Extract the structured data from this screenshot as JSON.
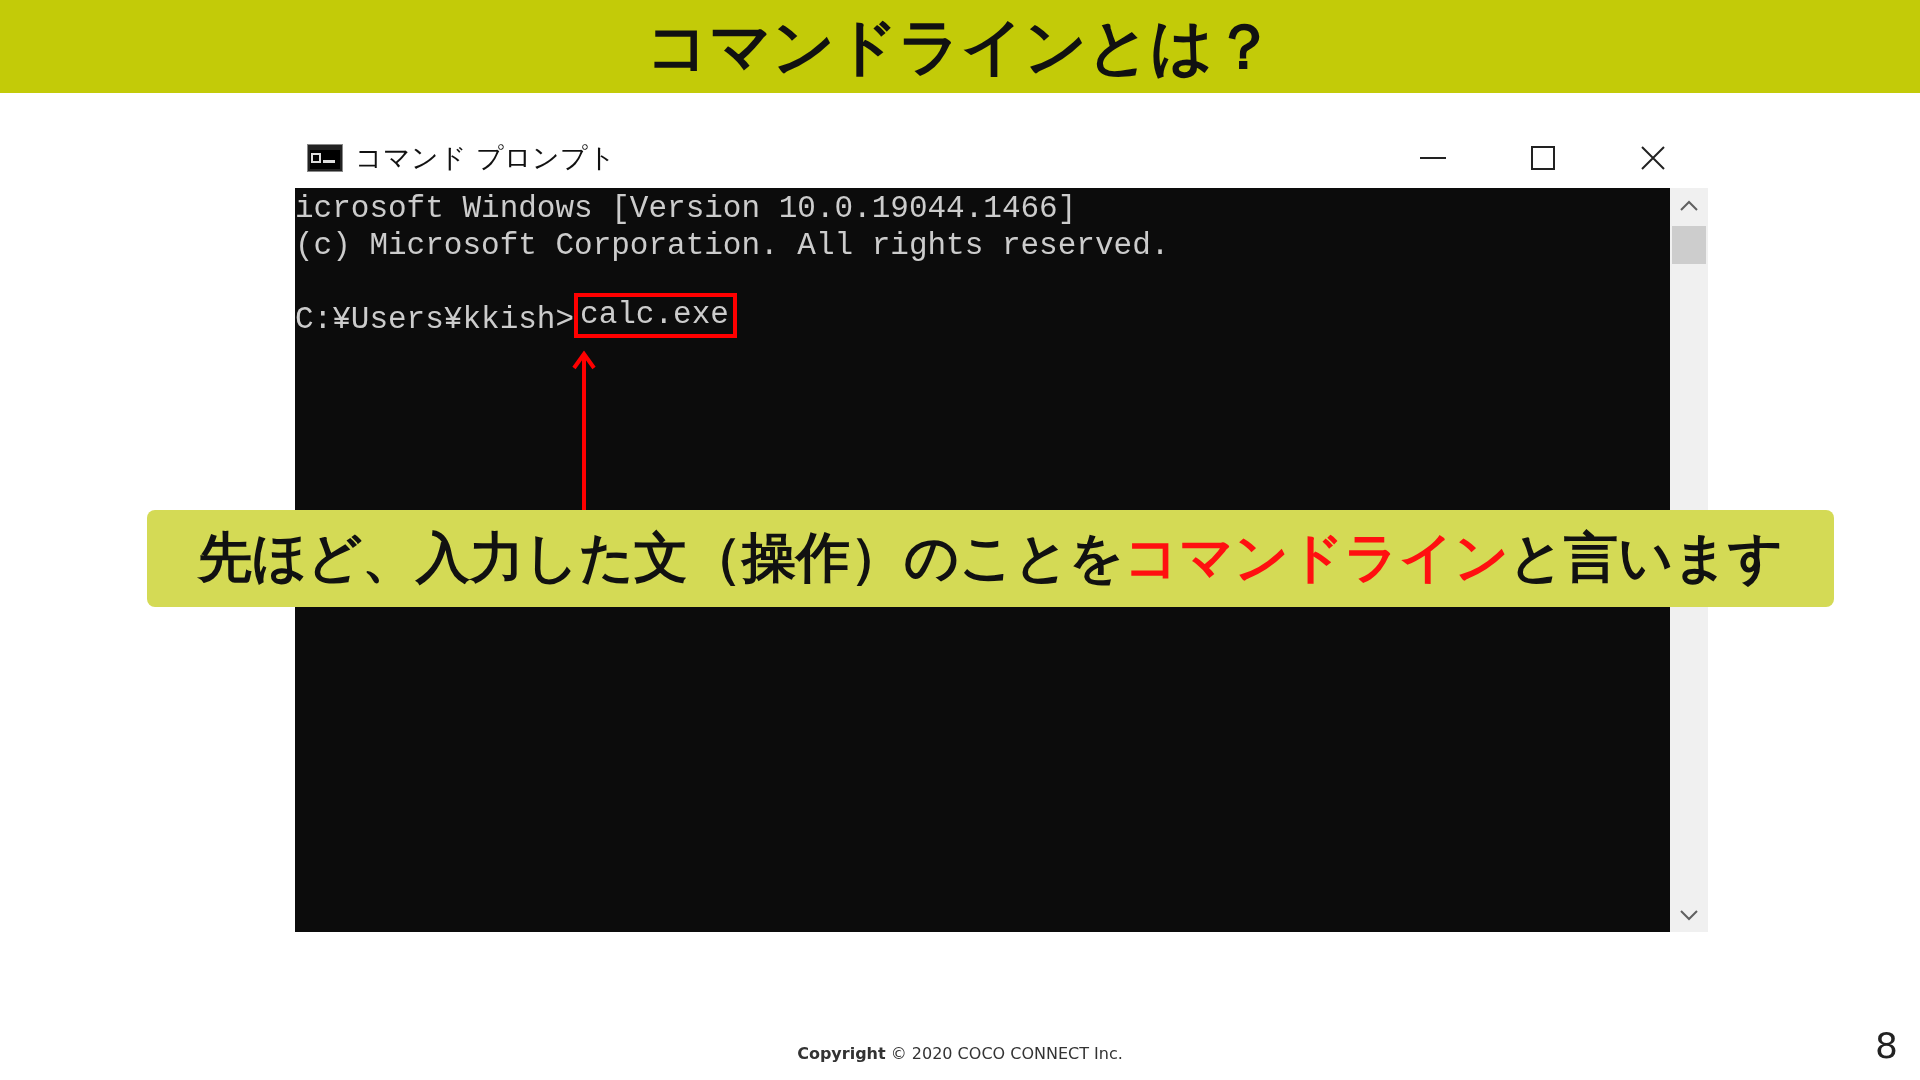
{
  "slide_title": "コマンドラインとは？",
  "window": {
    "title": "コマンド プロンプト",
    "console_lines": [
      {
        "kind": "plain",
        "text": "icrosoft Windows [Version 10.0.19044.1466]"
      },
      {
        "kind": "plain",
        "text": "(c) Microsoft Corporation. All rights reserved."
      },
      {
        "kind": "blank"
      },
      {
        "kind": "command",
        "prompt": "C:¥Users¥kkish>",
        "command": "calc.exe",
        "highlighted": true
      }
    ]
  },
  "callout": {
    "segments": [
      {
        "text": "先ほど、入力した文（操作）のことを",
        "emphasis": false
      },
      {
        "text": "コマンドライン",
        "emphasis": true
      },
      {
        "text": "と言います",
        "emphasis": false
      }
    ]
  },
  "footer": {
    "copyright": "**Copyright** © 2020 COCO CONNECT Inc.",
    "page_number": "8"
  }
}
